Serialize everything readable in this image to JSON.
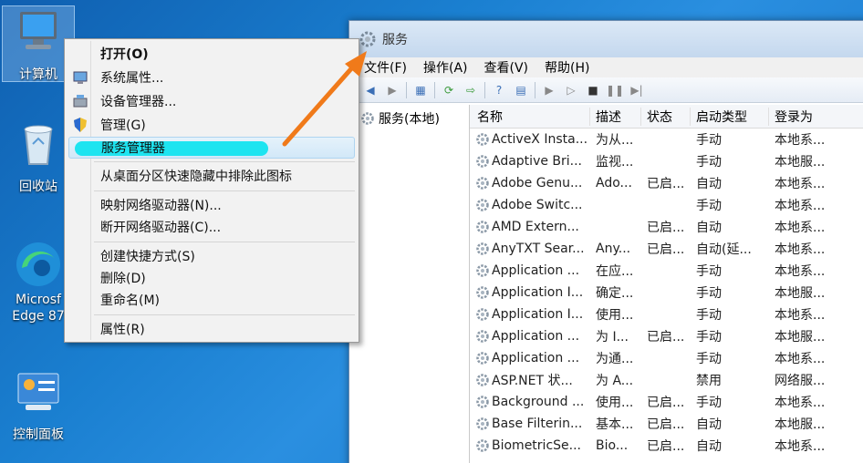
{
  "desktop": {
    "icons": [
      {
        "label": "计算机"
      },
      {
        "label": "回收站"
      },
      {
        "label": "Microsf\nEdge 87"
      },
      {
        "label": "控制面板"
      }
    ]
  },
  "window": {
    "title": "服务",
    "menu": [
      "文件(F)",
      "操作(A)",
      "查看(V)",
      "帮助(H)"
    ],
    "tree_item": "服务(本地)",
    "columns": [
      "名称",
      "描述",
      "状态",
      "启动类型",
      "登录为"
    ],
    "rows": [
      [
        "ActiveX Insta...",
        "为从...",
        "",
        "手动",
        "本地系..."
      ],
      [
        "Adaptive Bri...",
        "监视...",
        "",
        "手动",
        "本地服..."
      ],
      [
        "Adobe Genu...",
        "Ado...",
        "已启...",
        "自动",
        "本地系..."
      ],
      [
        "Adobe Switc...",
        "",
        "",
        "手动",
        "本地系..."
      ],
      [
        "AMD Extern...",
        "",
        "已启...",
        "自动",
        "本地系..."
      ],
      [
        "AnyTXT Sear...",
        "Any...",
        "已启...",
        "自动(延...",
        "本地系..."
      ],
      [
        "Application ...",
        "在应...",
        "",
        "手动",
        "本地系..."
      ],
      [
        "Application I...",
        "确定...",
        "",
        "手动",
        "本地服..."
      ],
      [
        "Application I...",
        "使用...",
        "",
        "手动",
        "本地系..."
      ],
      [
        "Application ...",
        "为 I...",
        "已启...",
        "手动",
        "本地服..."
      ],
      [
        "Application ...",
        "为通...",
        "",
        "手动",
        "本地系..."
      ],
      [
        "ASP.NET 状...",
        "为 A...",
        "",
        "禁用",
        "网络服..."
      ],
      [
        "Background ...",
        "使用...",
        "已启...",
        "手动",
        "本地系..."
      ],
      [
        "Base Filterin...",
        "基本...",
        "已启...",
        "自动",
        "本地服..."
      ],
      [
        "BiometricSe...",
        "Bio...",
        "已启...",
        "自动",
        "本地系..."
      ]
    ]
  },
  "context_menu": {
    "open": "打开(O)",
    "system_props": "系统属性...",
    "device_manager": "设备管理器...",
    "manage": "管理(G)",
    "service_manager": "服务管理器",
    "remove_from_desktop": "从桌面分区快速隐藏中排除此图标",
    "map_drive": "映射网络驱动器(N)...",
    "disconnect_drive": "断开网络驱动器(C)...",
    "create_shortcut": "创建快捷方式(S)",
    "delete": "删除(D)",
    "rename": "重命名(M)",
    "properties": "属性(R)"
  },
  "colors": {
    "highlight_pill": "#1de4f0",
    "arrow": "#f07a1a"
  }
}
